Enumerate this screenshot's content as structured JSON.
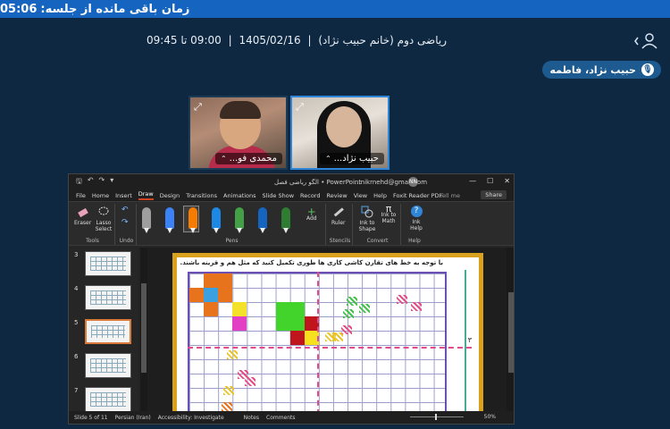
{
  "topbar": {
    "time_remaining_label": "زمان باقی مانده از جلسه:",
    "time_remaining_value": "05:06"
  },
  "header": {
    "course": "ریاضی دوم (خانم حبیب نژاد)",
    "date": "1405/02/16",
    "time_range": "09:00 تا 09:45"
  },
  "speaker": {
    "name": "حبیب نژاد، فاطمه"
  },
  "videos": [
    {
      "name": "محمدی فو..."
    },
    {
      "name": "حبیب نژاد..."
    }
  ],
  "ppt": {
    "doc_title": "الگو ریاضی فصل • PowerPoint",
    "account": "...nikrnehd@gmail.com",
    "avatar_initials": "NN",
    "menu": [
      "File",
      "Home",
      "Insert",
      "Draw",
      "Design",
      "Transitions",
      "Animations",
      "Slide Show",
      "Record",
      "Review",
      "View",
      "Help",
      "Foxit Reader PDF"
    ],
    "tell_me": "Tell me",
    "share": "Share",
    "ribbon": {
      "eraser": "Eraser",
      "lasso": "Lasso Select",
      "tools_label": "Tools",
      "undo_label": "Undo",
      "pens_label": "Pens",
      "add": "Add",
      "ruler": "Ruler",
      "stencils_label": "Stencils",
      "ink_to_shape": "Ink to Shape",
      "ink_to_math": "Ink to Math",
      "convert_label": "Convert",
      "ink_help": "Ink Help",
      "help_label": "Help"
    },
    "pens": [
      {
        "color": "#9e9e9e"
      },
      {
        "color": "#3b82f6"
      },
      {
        "color": "#f57c00"
      },
      {
        "color": "#1e88e5"
      },
      {
        "color": "#43a047"
      },
      {
        "color": "#1565c0"
      },
      {
        "color": "#2e7d32"
      }
    ],
    "thumbnails": [
      "3",
      "4",
      "5",
      "6",
      "7"
    ],
    "slide_text": "با توجه به خط های تقارن کاشی کاری ها طوری تکمیل کنید که مثل هم و قرینه باشند.",
    "slide_number_label": "۳",
    "status": {
      "slide_of": "Slide 5 of 11",
      "language": "Persian (Iran)",
      "accessibility": "Accessibility: Investigate",
      "notes": "Notes",
      "comments": "Comments",
      "zoom": "50%"
    }
  }
}
